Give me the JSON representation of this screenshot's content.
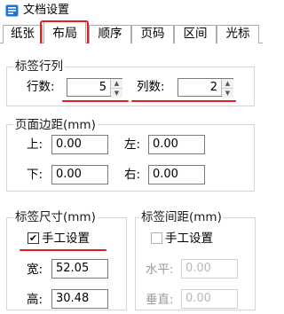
{
  "window": {
    "title": "文档设置"
  },
  "tabs": [
    {
      "label": "纸张",
      "active": false
    },
    {
      "label": "布局",
      "active": true
    },
    {
      "label": "顺序",
      "active": false
    },
    {
      "label": "页码",
      "active": false
    },
    {
      "label": "区间",
      "active": false
    },
    {
      "label": "光标",
      "active": false
    }
  ],
  "label_rows_cols": {
    "legend": "标签行列",
    "rows_label": "行数:",
    "rows_value": "5",
    "cols_label": "列数:",
    "cols_value": "2"
  },
  "page_margins": {
    "legend": "页面边距(mm)",
    "top_label": "上:",
    "top_value": "0.00",
    "left_label": "左:",
    "left_value": "0.00",
    "bottom_label": "下:",
    "bottom_value": "0.00",
    "right_label": "右:",
    "right_value": "0.00"
  },
  "label_size": {
    "legend": "标签尺寸(mm)",
    "manual_label": "手工设置",
    "manual_checked": true,
    "width_label": "宽:",
    "width_value": "52.05",
    "height_label": "高:",
    "height_value": "30.48"
  },
  "label_spacing": {
    "legend": "标签间距(mm)",
    "manual_label": "手工设置",
    "manual_checked": false,
    "horizontal_label": "水平:",
    "horizontal_value": "0.00",
    "vertical_label": "垂直:",
    "vertical_value": "0.00"
  },
  "colors": {
    "annotation": "#e01e1e",
    "border": "#adadad"
  }
}
